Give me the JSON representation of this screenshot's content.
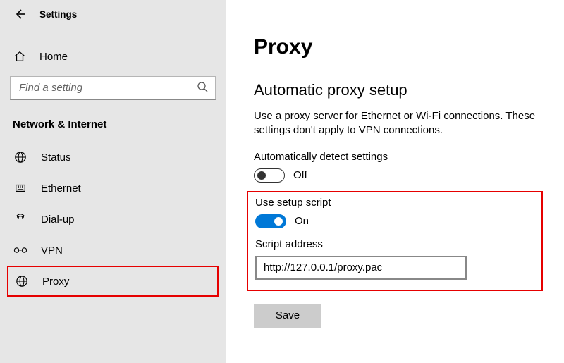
{
  "window": {
    "title": "Settings"
  },
  "sidebar": {
    "home_label": "Home",
    "search_placeholder": "Find a setting",
    "category": "Network & Internet",
    "items": [
      {
        "key": "status",
        "label": "Status"
      },
      {
        "key": "ethernet",
        "label": "Ethernet"
      },
      {
        "key": "dialup",
        "label": "Dial-up"
      },
      {
        "key": "vpn",
        "label": "VPN"
      },
      {
        "key": "proxy",
        "label": "Proxy"
      }
    ],
    "active_key": "proxy"
  },
  "main": {
    "heading": "Proxy",
    "section_title": "Automatic proxy setup",
    "description": "Use a proxy server for Ethernet or Wi-Fi connections. These settings don't apply to VPN connections.",
    "auto_detect": {
      "label": "Automatically detect settings",
      "on": false,
      "state_text": "Off"
    },
    "setup_script": {
      "label": "Use setup script",
      "on": true,
      "state_text": "On",
      "address_label": "Script address",
      "address_value": "http://127.0.0.1/proxy.pac"
    },
    "save_label": "Save"
  }
}
